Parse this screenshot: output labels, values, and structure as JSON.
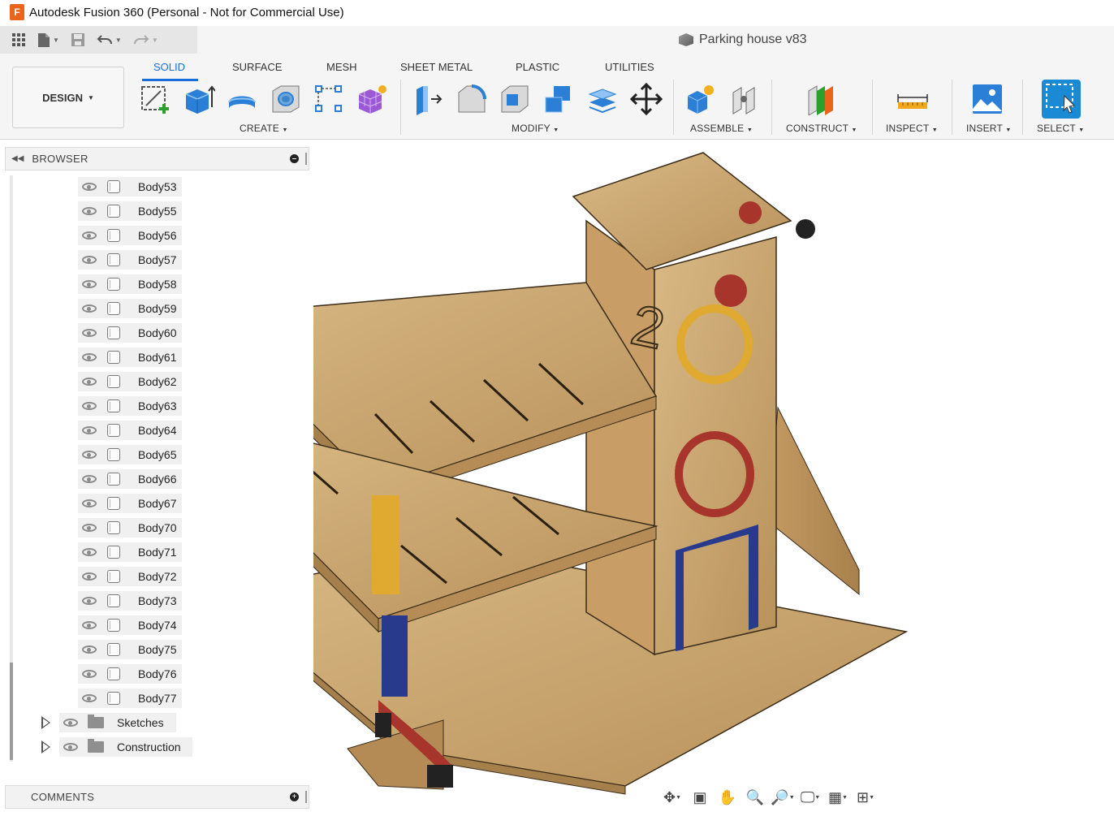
{
  "window": {
    "title": "Autodesk Fusion 360 (Personal - Not for Commercial Use)",
    "app_icon_letter": "F"
  },
  "document": {
    "title": "Parking house v83"
  },
  "workspace": {
    "label": "DESIGN"
  },
  "ribbon": {
    "tabs": [
      {
        "label": "SOLID",
        "active": true
      },
      {
        "label": "SURFACE",
        "active": false
      },
      {
        "label": "MESH",
        "active": false
      },
      {
        "label": "SHEET METAL",
        "active": false
      },
      {
        "label": "PLASTIC",
        "active": false
      },
      {
        "label": "UTILITIES",
        "active": false
      }
    ],
    "groups": [
      "CREATE",
      "MODIFY",
      "ASSEMBLE",
      "CONSTRUCT",
      "INSPECT",
      "INSERT",
      "SELECT"
    ]
  },
  "browser": {
    "title": "BROWSER",
    "bodies": [
      "Body53",
      "Body55",
      "Body56",
      "Body57",
      "Body58",
      "Body59",
      "Body60",
      "Body61",
      "Body62",
      "Body63",
      "Body64",
      "Body65",
      "Body66",
      "Body67",
      "Body70",
      "Body71",
      "Body72",
      "Body73",
      "Body74",
      "Body75",
      "Body76",
      "Body77"
    ],
    "folders": [
      "Sketches",
      "Construction"
    ]
  },
  "comments": {
    "title": "COMMENTS"
  },
  "colors": {
    "accent": "#1a6fd6",
    "wood": "#c8a56d",
    "red": "#a8352c",
    "yellow": "#e0a930",
    "blue": "#283a8c",
    "green": "#2e8a3a"
  },
  "navbar": {
    "icons": [
      "orbit-icon",
      "look-at-icon",
      "pan-icon",
      "zoom-window-icon",
      "zoom-icon",
      "display-settings-icon",
      "grid-icon",
      "viewports-icon"
    ]
  }
}
